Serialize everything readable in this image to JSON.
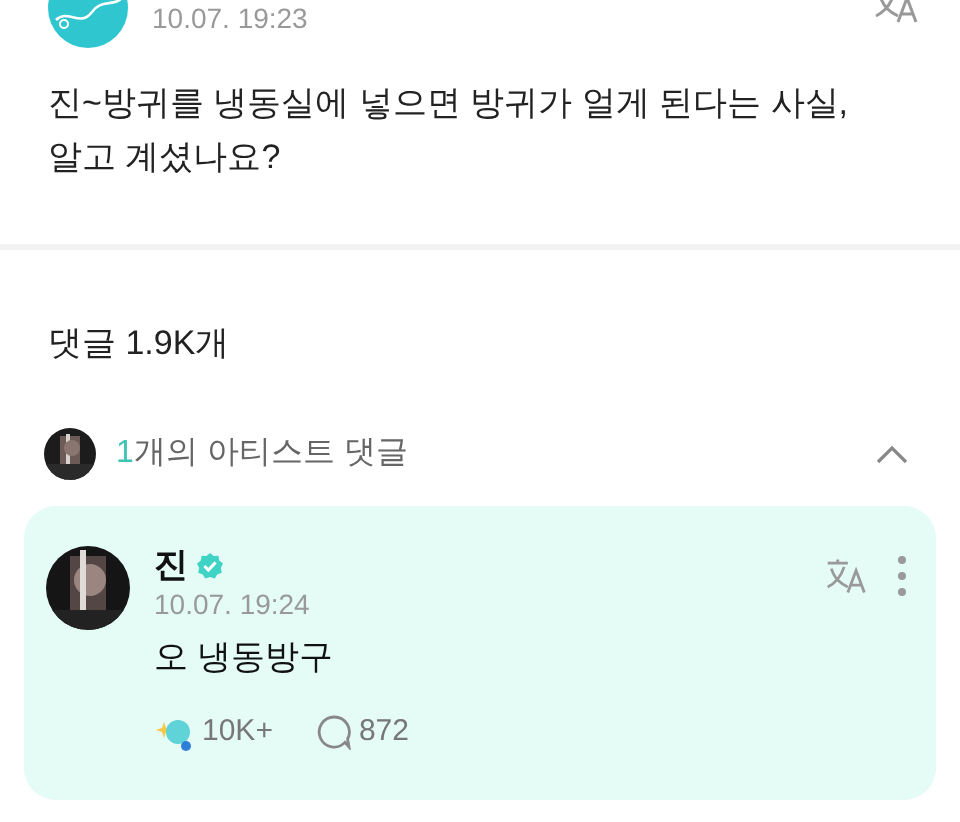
{
  "post": {
    "timestamp": "10.07. 19:23",
    "text": "진~방귀를 냉동실에 넣으면 방귀가 얼게 된다는 사실, 알고 계셨나요?"
  },
  "comments_header": "댓글 1.9K개",
  "artist_comments": {
    "count": "1",
    "label": "개의 아티스트 댓글",
    "expanded": true
  },
  "comment": {
    "author": "진",
    "verified": true,
    "timestamp": "10.07. 19:24",
    "text": "오 냉동방구",
    "likes": "10K+",
    "replies": "872"
  }
}
